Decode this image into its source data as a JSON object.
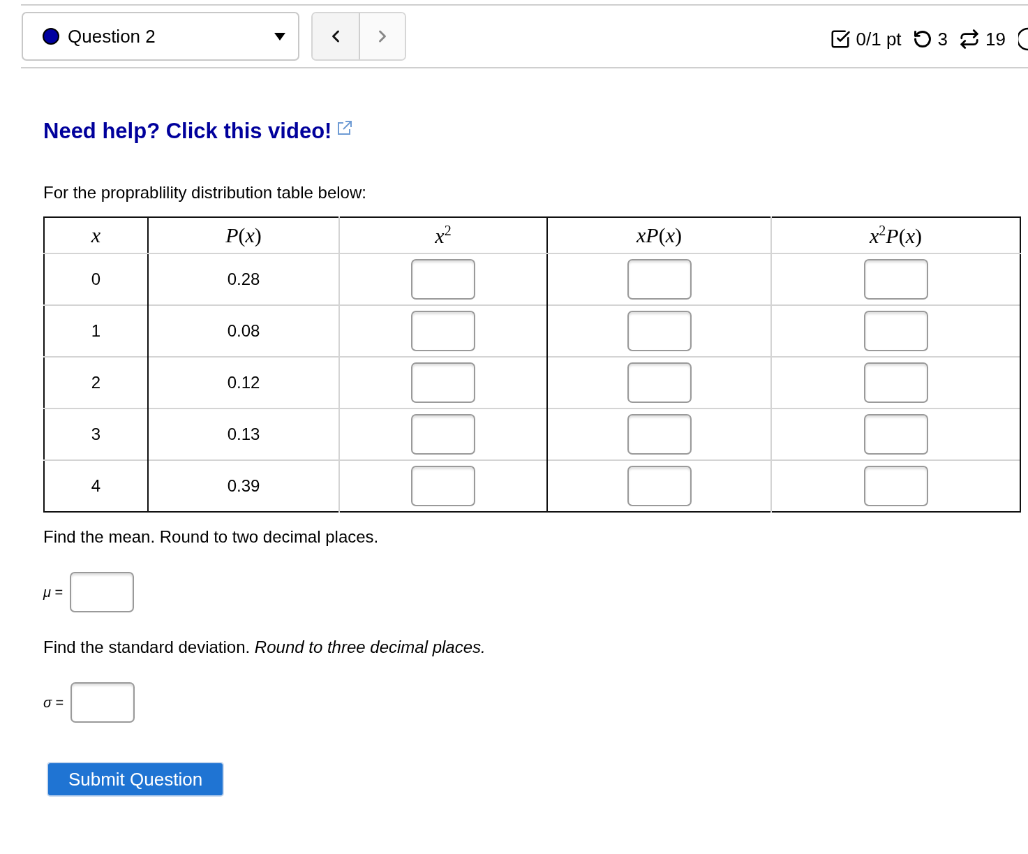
{
  "toolbar": {
    "question_select": {
      "value": "Question 2"
    },
    "nav_buttons": [
      {
        "kind": "prev",
        "disabled": false
      },
      {
        "kind": "next",
        "disabled": true
      }
    ],
    "score": {
      "points": "0/1 pt",
      "retries": "3",
      "attempts": "19"
    }
  },
  "help_link": {
    "text": "Need help? Click this video!"
  },
  "intro": "For the proprablility distribution table below:",
  "table": {
    "columns": [
      {
        "label": "*x*"
      },
      {
        "label": "*P*(*x*)"
      },
      {
        "label": "*x*$^{2}$"
      },
      {
        "label": "*xP*(*x*)"
      },
      {
        "label": "*x*$^{2}$*P*(*x*)"
      }
    ],
    "rows": [
      {
        "cells": [
          {
            "kind": "text",
            "value": "0"
          },
          {
            "kind": "text",
            "value": "0.28"
          },
          {
            "kind": "input"
          },
          {
            "kind": "input"
          },
          {
            "kind": "input"
          }
        ]
      },
      {
        "cells": [
          {
            "kind": "text",
            "value": "1"
          },
          {
            "kind": "text",
            "value": "0.08"
          },
          {
            "kind": "input"
          },
          {
            "kind": "input"
          },
          {
            "kind": "input"
          }
        ]
      },
      {
        "cells": [
          {
            "kind": "text",
            "value": "2"
          },
          {
            "kind": "text",
            "value": "0.12"
          },
          {
            "kind": "input"
          },
          {
            "kind": "input"
          },
          {
            "kind": "input"
          }
        ]
      },
      {
        "cells": [
          {
            "kind": "text",
            "value": "3"
          },
          {
            "kind": "text",
            "value": "0.13"
          },
          {
            "kind": "input"
          },
          {
            "kind": "input"
          },
          {
            "kind": "input"
          }
        ]
      },
      {
        "cells": [
          {
            "kind": "text",
            "value": "4"
          },
          {
            "kind": "text",
            "value": "0.39"
          },
          {
            "kind": "input"
          },
          {
            "kind": "input"
          },
          {
            "kind": "input"
          }
        ]
      }
    ]
  },
  "questions": [
    {
      "prompt": "Find the mean. Round to two decimal places.",
      "symbol": "*μ* ="
    },
    {
      "prompt": "Find the standard deviation. *Round to three decimal places.*",
      "symbol": "*σ* ="
    }
  ],
  "submit_button": {
    "label": "Submit Question"
  }
}
